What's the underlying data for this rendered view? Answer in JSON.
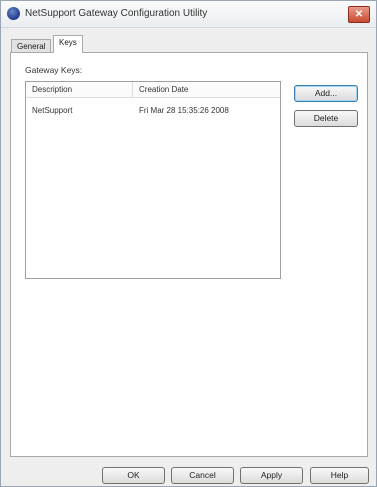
{
  "window": {
    "title": "NetSupport Gateway Configuration Utility",
    "close_label": "✕"
  },
  "tabs": [
    {
      "label": "General",
      "active": false
    },
    {
      "label": "Keys",
      "active": true
    }
  ],
  "keys": {
    "group_label": "Gateway Keys:",
    "columns": [
      "Description",
      "Creation Date"
    ],
    "rows": [
      {
        "description": "NetSupport",
        "creation_date": "Fri Mar 28 15:35:26 2008"
      }
    ],
    "add_label": "Add...",
    "delete_label": "Delete"
  },
  "footer": {
    "ok_label": "OK",
    "cancel_label": "Cancel",
    "apply_label": "Apply",
    "help_label": "Help"
  },
  "colors": {
    "close_button": "#c94a32",
    "focus_border": "#3c7fb1"
  }
}
